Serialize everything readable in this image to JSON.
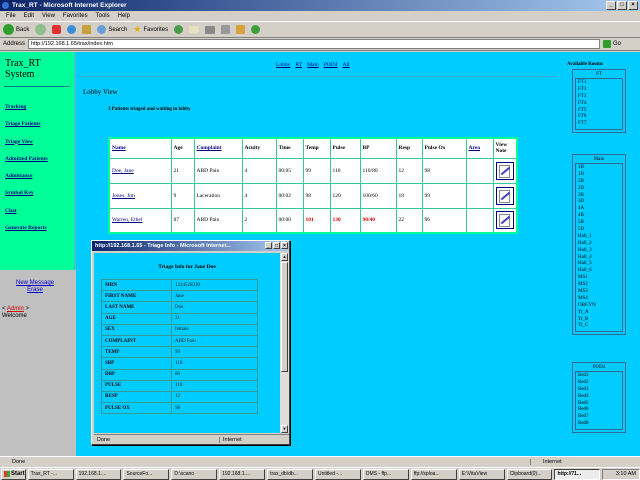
{
  "window": {
    "title": "Trax_RT - Microsoft Internet Explorer"
  },
  "menu": [
    "File",
    "Edit",
    "View",
    "Favorites",
    "Tools",
    "Help"
  ],
  "toolbar": {
    "back": "Back",
    "search": "Search",
    "favorites": "Favorites"
  },
  "address": {
    "label": "Address",
    "url": "http://192.168.1.65/trax/index.htm",
    "go": "Go"
  },
  "sidebar": {
    "title": "Trax_RT System",
    "links": [
      "Tracking",
      "Triage Patients",
      "Triage View",
      "Admitted Patients",
      "Admittance",
      "Symbol Key",
      "Chat",
      "Generate Reports"
    ],
    "new_message": "New Message Erase",
    "user_prefix": "<",
    "user_name": "Admin",
    "user_suffix": ">",
    "welcome": "Welcome"
  },
  "main": {
    "top_links": [
      "Lobby",
      "RT",
      "Main",
      "POD4",
      "All"
    ],
    "view_title": "Lobby View",
    "patients_note": "3 Patients triaged and waiting in lobby"
  },
  "patient_table": {
    "headers": [
      "Name",
      "Age",
      "Complaint",
      "Acuity",
      "Time",
      "Temp",
      "Pulse",
      "BP",
      "Resp",
      "Pulse Ox",
      "Area",
      "View Note"
    ],
    "rows": [
      {
        "name": "Doe, Jane",
        "age": "21",
        "complaint": "ABD Pain",
        "acuity": "4",
        "time": "00:05",
        "temp": "99",
        "pulse": "110",
        "bp": "110/80",
        "resp": "12",
        "pulse_ox": "98",
        "area": ""
      },
      {
        "name": "Jones, Jim",
        "age": "9",
        "complaint": "Laceration",
        "acuity": "4",
        "time": "00:02",
        "temp": "98",
        "pulse": "120",
        "bp": "100/60",
        "resp": "18",
        "pulse_ox": "99",
        "area": ""
      },
      {
        "name": "Warren, Ethel",
        "age": "87",
        "complaint": "ABD Pain",
        "acuity": "2",
        "time": "00:00",
        "temp": "101",
        "pulse": "130",
        "bp": "90/40",
        "resp": "22",
        "pulse_ox": "96",
        "area": ""
      }
    ]
  },
  "rooms": {
    "title_line1": "Available Rooms",
    "groups": [
      {
        "name": "FT",
        "rooms": [
          "FT1",
          "FT2",
          "FT3",
          "FT4",
          "FT5",
          "FT6",
          "FT7"
        ]
      },
      {
        "name": "Main",
        "rooms": [
          "1B",
          "1D",
          "2B",
          "2D",
          "3B",
          "3D",
          "4A",
          "4B",
          "5B",
          "5D",
          "Hall_1",
          "Hall_2",
          "Hall_3",
          "Hall_4",
          "Hall_5",
          "Hall_6",
          "MS1",
          "MS2",
          "MS3",
          "MS4",
          "OBGYN",
          "Tr_A",
          "Tr_B",
          "Tr_C"
        ]
      },
      {
        "name": "POD4",
        "rooms": [
          "Bed1",
          "Bed2",
          "Bed3",
          "Bed4",
          "Bed5",
          "Bed6",
          "Bed7",
          "Bed8"
        ]
      }
    ]
  },
  "popup": {
    "title": "http://192.168.1.65 - Triage Info - Microsoft Internet...",
    "heading": "Triage Info for Jane Doe",
    "fields": [
      {
        "k": "MRN",
        "v": "1234528330"
      },
      {
        "k": "FIRST NAME",
        "v": "Jane"
      },
      {
        "k": "LAST NAME",
        "v": "Doe"
      },
      {
        "k": "AGE",
        "v": "21"
      },
      {
        "k": "SEX",
        "v": "female"
      },
      {
        "k": "COMPLAINT",
        "v": "ABD Pain"
      },
      {
        "k": "TEMP",
        "v": "99"
      },
      {
        "k": "SBP",
        "v": "110"
      },
      {
        "k": "DBP",
        "v": "80"
      },
      {
        "k": "PULSE",
        "v": "110"
      },
      {
        "k": "RESP",
        "v": "12"
      },
      {
        "k": "PULSE OX",
        "v": "98"
      }
    ],
    "status_left": "Done",
    "status_zone": "Internet"
  },
  "status_bar": {
    "left": "Done",
    "zone": "Internet"
  },
  "taskbar": {
    "start": "Start",
    "tasks": [
      "Trax_RT -...",
      "192.168.1....",
      "SourceFo...",
      "D:\\xcano",
      "192.168.1....",
      "trax_db\\db...",
      "Untitled -...",
      "DMS - ffp...",
      "ffp://sploa...",
      "E:\\VitaView",
      "Clipboard(0)...",
      "http://71..."
    ],
    "clock": "3:10 AM"
  }
}
